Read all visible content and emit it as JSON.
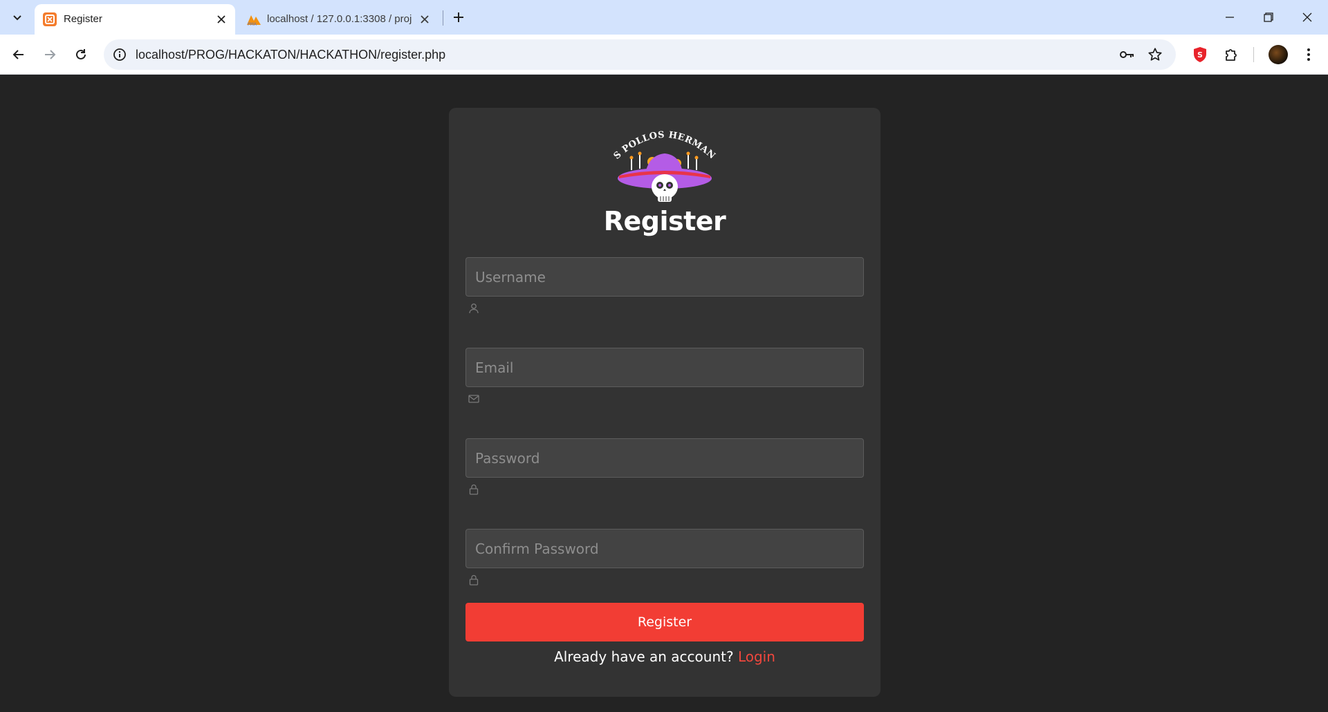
{
  "browser": {
    "tabs": [
      {
        "title": "Register",
        "active": true
      },
      {
        "title": "localhost / 127.0.0.1:3308 / proj",
        "active": false
      }
    ],
    "url": "localhost/PROG/HACKATON/HACKATHON/register.php",
    "icons": {
      "tab_search": "chevron-down-icon",
      "back": "arrow-left-icon",
      "forward": "arrow-right-icon",
      "reload": "reload-icon",
      "site_info": "info-icon",
      "password_key": "key-icon",
      "bookmark": "star-icon",
      "extension_shield": "shield-icon",
      "extensions": "puzzle-icon",
      "menu": "kebab-menu-icon"
    }
  },
  "logo": {
    "text": "LOS POLLOS HERMANOS",
    "colors": {
      "hat": "#b45ce6",
      "band": "#e8344a",
      "skull": "#ffffff"
    }
  },
  "form": {
    "heading": "Register",
    "fields": [
      {
        "name": "username",
        "placeholder": "Username",
        "icon": "user-icon"
      },
      {
        "name": "email",
        "placeholder": "Email",
        "icon": "envelope-icon"
      },
      {
        "name": "password",
        "placeholder": "Password",
        "icon": "lock-icon"
      },
      {
        "name": "confirm_password",
        "placeholder": "Confirm Password",
        "icon": "lock-icon"
      }
    ],
    "submit_label": "Register",
    "footer_text": "Already have an account?",
    "footer_link": "Login"
  },
  "colors": {
    "page_bg": "#232323",
    "card_bg": "#333333",
    "accent": "#f23d34",
    "input_bg": "#434343"
  }
}
